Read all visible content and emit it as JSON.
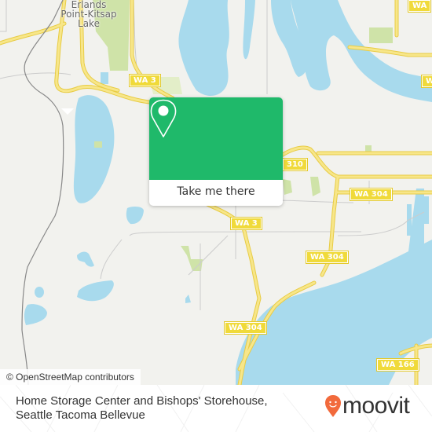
{
  "map": {
    "place_labels": [
      {
        "name": "Erlands Point-Kitsap Lake",
        "lines": [
          "Erlands",
          "Point-Kitsap",
          "Lake"
        ]
      }
    ],
    "route_shields": [
      {
        "label": "WA 3"
      },
      {
        "label": "310"
      },
      {
        "label": "WA 304"
      },
      {
        "label": "WA 3"
      },
      {
        "label": "WA 304"
      },
      {
        "label": "WA 304"
      },
      {
        "label": "WA 166"
      },
      {
        "label": "WA"
      },
      {
        "label": "W"
      }
    ],
    "colors": {
      "land": "#f2f2ee",
      "water": "#a8daed",
      "park": "#cfe3a8",
      "major_road": "#f5e27a",
      "minor_road": "#c8c8c8",
      "rail": "#888888"
    },
    "attribution": "© OpenStreetMap contributors"
  },
  "popup": {
    "icon": "map-pin-icon",
    "button_label": "Take me there",
    "color": "#1fb96a"
  },
  "footer": {
    "place_name_line1": "Home Storage Center and Bishops' Storehouse,",
    "place_name_line2": "Seattle Tacoma Bellevue",
    "brand": "moovit",
    "brand_color": "#f26a3c"
  }
}
